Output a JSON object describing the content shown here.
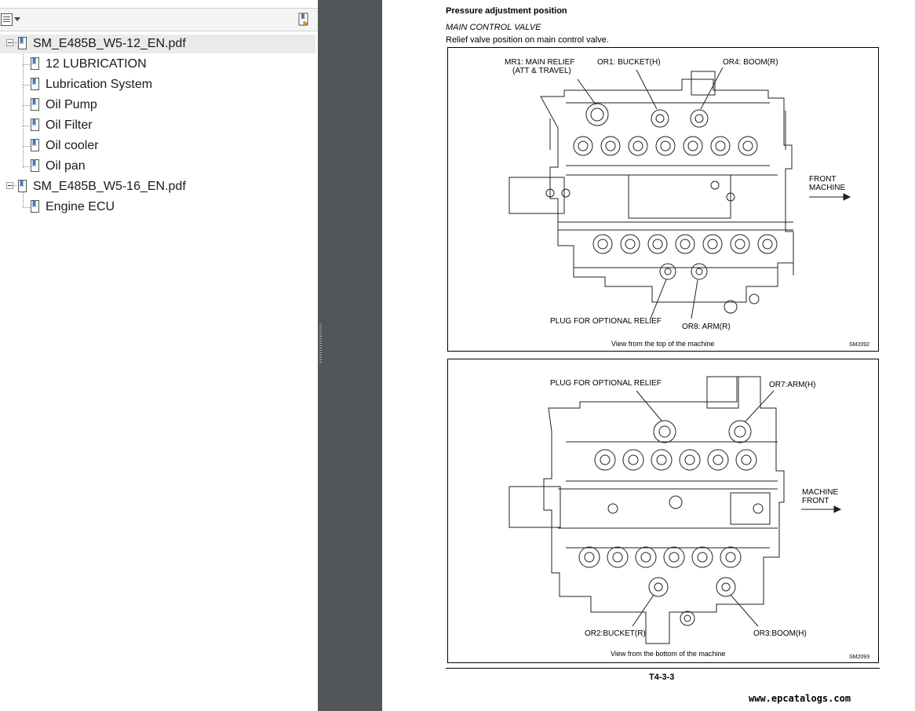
{
  "bookmarks_panel": {
    "items": [
      {
        "label": "SM_E485B_W5-12_EN.pdf",
        "level": 0,
        "expanded": true,
        "selected": true
      },
      {
        "label": "12 LUBRICATION",
        "level": 1
      },
      {
        "label": "Lubrication System",
        "level": 1
      },
      {
        "label": "Oil Pump",
        "level": 1
      },
      {
        "label": "Oil Filter",
        "level": 1
      },
      {
        "label": "Oil cooler",
        "level": 1
      },
      {
        "label": "Oil pan",
        "level": 1
      },
      {
        "label": "SM_E485B_W5-16_EN.pdf",
        "level": 0,
        "expanded": true
      },
      {
        "label": "Engine ECU",
        "level": 1
      }
    ]
  },
  "document_page": {
    "heading": "Pressure adjustment position",
    "subheading": "MAIN CONTROL VALVE",
    "description": "Relief valve position on main control valve.",
    "figure_top": {
      "callout_mr1": "MR1: MAIN RELIEF",
      "callout_mr1_sub": "(ATT & TRAVEL)",
      "callout_or1": "OR1: BUCKET(H)",
      "callout_or4": "OR4: BOOM(R)",
      "callout_plug": "PLUG FOR OPTIONAL RELIEF",
      "callout_or8": "OR8: ARM(R)",
      "direction_line1": "FRONT",
      "direction_line2": "MACHINE",
      "caption": "View from the top of the machine",
      "code": "SM2092"
    },
    "figure_bottom": {
      "callout_plug": "PLUG FOR OPTIONAL RELIEF",
      "callout_or7": "OR7:ARM(H)",
      "callout_or2": "OR2:BUCKET(R)",
      "callout_or3": "OR3:BOOM(H)",
      "direction_line1": "MACHINE",
      "direction_line2": "FRONT",
      "caption": "View from the bottom of the machine",
      "code": "SM2093"
    },
    "page_number": "T4-3-3",
    "watermark": "www.epcatalogs.com"
  },
  "colors": {
    "viewer_background": "#525659",
    "panel_background": "#ffffff",
    "selected_row": "#eaeaea",
    "bookmark_icon": "#4a78b5"
  },
  "icons": [
    "options-menu-icon",
    "expand-bookmark-icon",
    "collapse-toggle-icon",
    "bookmark-icon",
    "arrow-right-icon"
  ]
}
